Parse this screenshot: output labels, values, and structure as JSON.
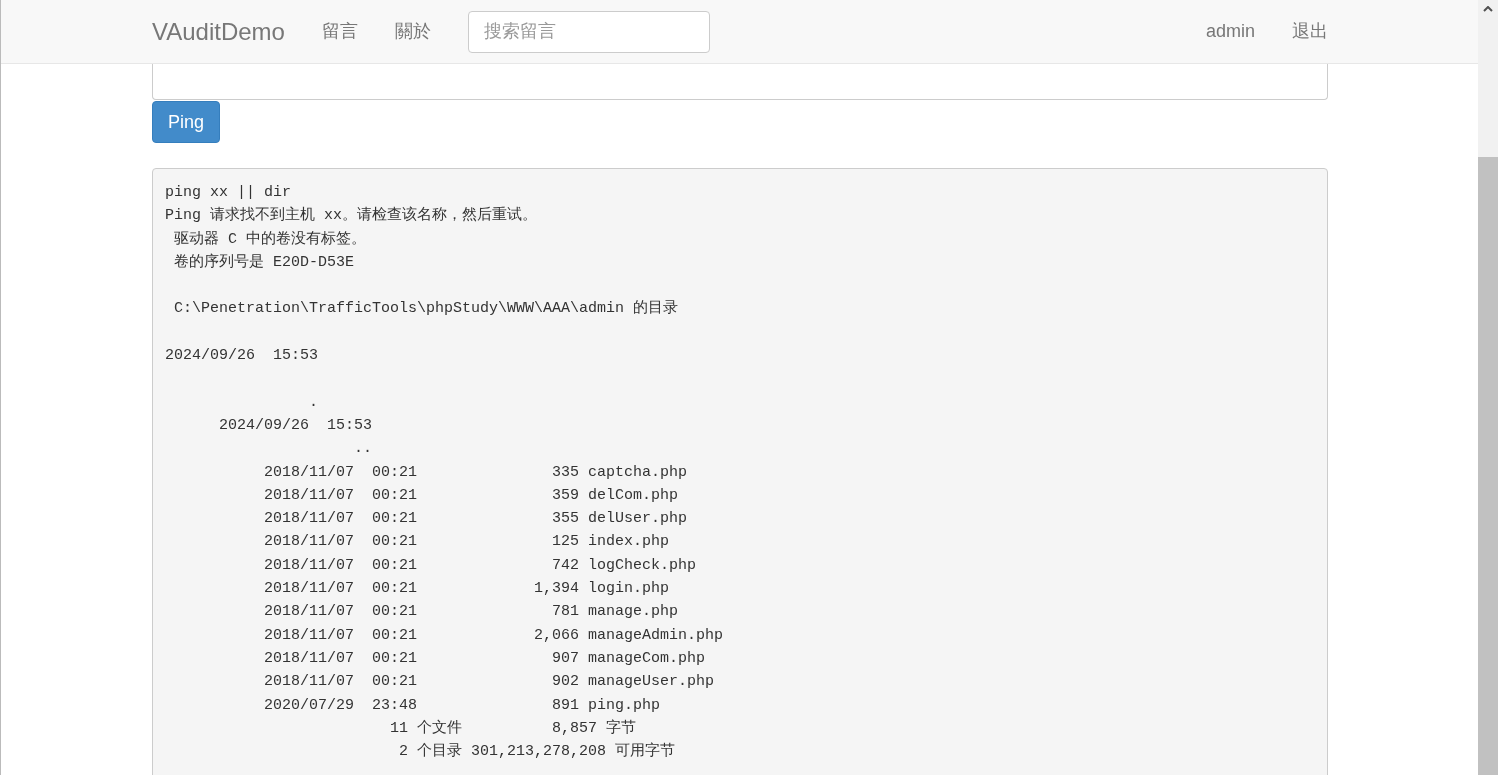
{
  "navbar": {
    "brand": "VAuditDemo",
    "links": [
      "留言",
      "關於"
    ],
    "search": {
      "placeholder": "搜索留言"
    },
    "right_links": [
      "admin",
      "退出"
    ]
  },
  "ping_button": "Ping",
  "output_blocks": [
    [
      "ping xx || dir",
      "Ping 请求找不到主机 xx。请检查该名称，然后重试。",
      " 驱动器 C 中的卷没有标签。",
      " 卷的序列号是 E20D-D53E"
    ],
    [
      " C:\\Penetration\\TrafficTools\\phpStudy\\WWW\\AAA\\admin 的目录"
    ],
    [
      "2024/09/26  15:53"
    ],
    [
      "                .",
      "      2024/09/26  15:53",
      "                     ..",
      "           2018/11/07  00:21               335 captcha.php",
      "           2018/11/07  00:21               359 delCom.php",
      "           2018/11/07  00:21               355 delUser.php",
      "           2018/11/07  00:21               125 index.php",
      "           2018/11/07  00:21               742 logCheck.php",
      "           2018/11/07  00:21             1,394 login.php",
      "           2018/11/07  00:21               781 manage.php",
      "           2018/11/07  00:21             2,066 manageAdmin.php",
      "           2018/11/07  00:21               907 manageCom.php",
      "           2018/11/07  00:21               902 manageUser.php",
      "           2020/07/29  23:48               891 ping.php",
      "                         11 个文件          8,857 字节",
      "                          2 个目录 301,213,278,208 可用字节"
    ]
  ]
}
